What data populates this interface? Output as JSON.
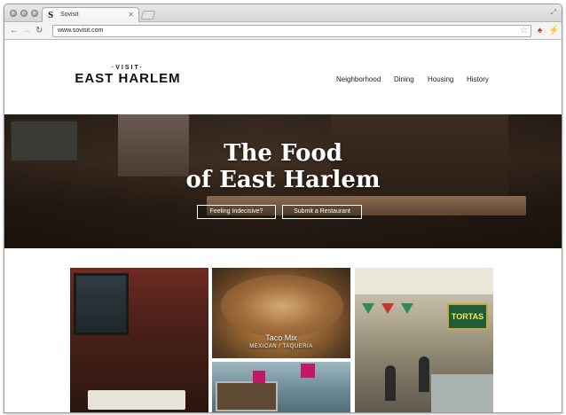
{
  "browser": {
    "tab_title": "Sovisit",
    "tab_favicon": "S",
    "url": "www.sovisit.com"
  },
  "site": {
    "logo_top": "·VISIT·",
    "logo_name": "EAST HARLEM",
    "nav": [
      "Neighborhood",
      "Dining",
      "Housing",
      "History"
    ]
  },
  "hero": {
    "title_line1": "The Food",
    "title_line2": "of East Harlem",
    "btn_indecisive": "Feeling Indecisive?",
    "btn_submit": "Submit a Restaurant"
  },
  "tiles": [
    {
      "name": "Taco Mix",
      "type": "MEXICAN / TAQUERIA"
    }
  ],
  "tile_sign": "TORTAS",
  "colors": {
    "accent_magenta": "#c2186b",
    "sign_green": "#1f5c3a"
  }
}
